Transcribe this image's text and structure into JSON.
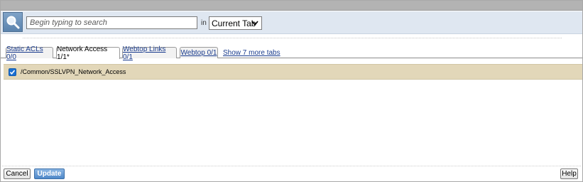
{
  "search": {
    "placeholder": "Begin typing to search",
    "in_label": "in",
    "scope_value": "Current Tab"
  },
  "tabs": [
    {
      "label": "Static ACLs 0/0",
      "active": false
    },
    {
      "label": "Network Access 1/1*",
      "active": true
    },
    {
      "label": "Webtop Links 0/1",
      "active": false
    },
    {
      "label": "Webtop 0/1",
      "active": false
    }
  ],
  "more_tabs_label": "Show 7 more tabs",
  "rows": [
    {
      "label": "/Common/SSLVPN_Network_Access",
      "checked": true
    }
  ],
  "footer": {
    "cancel_label": "Cancel",
    "update_label": "Update",
    "help_label": "Help"
  },
  "colors": {
    "selected_row_bg": "#e2d7b9",
    "search_bar_bg": "#dfe7f1",
    "link_color": "#1a3c8e"
  }
}
